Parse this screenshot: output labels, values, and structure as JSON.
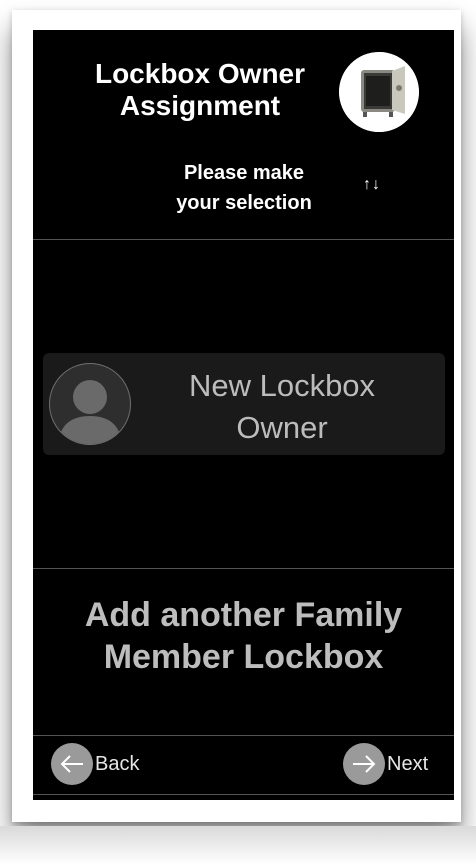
{
  "header": {
    "title": "Lockbox Owner\nAssignment",
    "subtitle": "Please make\nyour selection",
    "sort_glyph": "↑↓",
    "safe_icon": "safe-icon"
  },
  "owner_option": {
    "label": "New Lockbox\nOwner",
    "avatar_icon": "person-silhouette"
  },
  "add_member": {
    "label": "Add another Family\nMember Lockbox"
  },
  "nav": {
    "back_label": "Back",
    "next_label": "Next"
  },
  "colors": {
    "screen_bg": "#000000",
    "card_bg": "#1a1a1a",
    "muted_text": "#bdbdbd",
    "nav_circle": "#9a9a9a"
  }
}
